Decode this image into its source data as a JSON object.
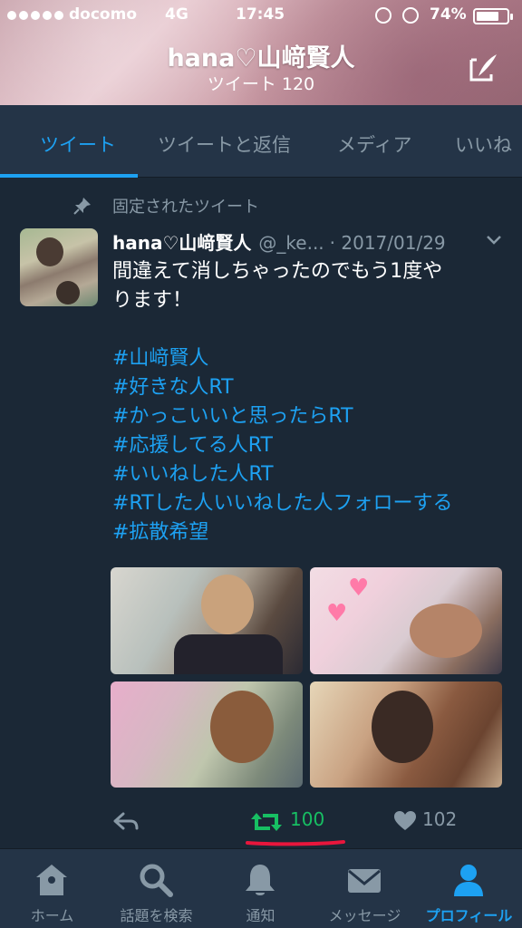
{
  "status_bar": {
    "carrier": "docomo",
    "network": "4G",
    "time": "17:45",
    "battery": "74%",
    "battery_level": 0.74
  },
  "header": {
    "name": "hana♡山﨑賢人",
    "tweet_count": "ツイート 120",
    "compose_icon": "compose-icon"
  },
  "tabs": [
    {
      "label": "ツイート",
      "active": true
    },
    {
      "label": "ツイートと返信",
      "active": false
    },
    {
      "label": "メディア",
      "active": false
    },
    {
      "label": "いいね",
      "active": false
    }
  ],
  "tweet": {
    "pinned_label": "固定されたツイート",
    "name": "hana♡山﨑賢人",
    "handle": "@_ke...",
    "date": "· 2017/01/29",
    "text_line1": "間違えて消しちゃったのでもう1度や",
    "text_line2": "ります！",
    "hashtags": [
      "#山﨑賢人",
      "#好きな人RT",
      "#かっこいいと思ったらRT",
      "#応援してる人RT",
      "#いいねした人RT",
      "#RTした人いいねした人フォローする",
      "#拡散希望"
    ],
    "retweet_count": "100",
    "like_count": "102"
  },
  "tabbar": [
    {
      "label": "ホーム",
      "icon": "home-icon",
      "active": false
    },
    {
      "label": "話題を検索",
      "icon": "search-icon",
      "active": false
    },
    {
      "label": "通知",
      "icon": "bell-icon",
      "active": false
    },
    {
      "label": "メッセージ",
      "icon": "mail-icon",
      "active": false
    },
    {
      "label": "プロフィール",
      "icon": "person-icon",
      "active": true
    }
  ],
  "colors": {
    "accent": "#1da1f2",
    "retweet": "#17bf63",
    "background": "#1b2836",
    "annotation": "#e8163c"
  }
}
